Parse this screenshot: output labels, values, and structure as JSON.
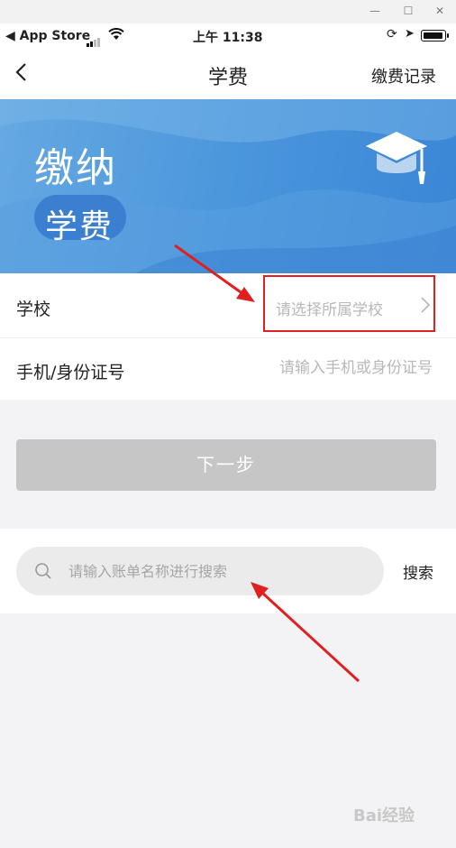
{
  "status": {
    "back_app": "◀ App Store",
    "time": "上午 11:38"
  },
  "nav": {
    "title": "学费",
    "right_link": "缴费记录"
  },
  "banner": {
    "title": "缴纳",
    "subtitle": "学费"
  },
  "form": {
    "school_label": "学校",
    "school_placeholder": "请选择所属学校",
    "phone_label": "手机/身份证号",
    "phone_placeholder": "请输入手机或身份证号",
    "next_button": "下一步"
  },
  "search": {
    "placeholder": "请输入账单名称进行搜索",
    "button": "搜索"
  },
  "watermark": "Bai经验",
  "colors": {
    "banner": "#4b96dc",
    "annotation": "#e02020",
    "disabled_button": "#c6c6c6"
  }
}
